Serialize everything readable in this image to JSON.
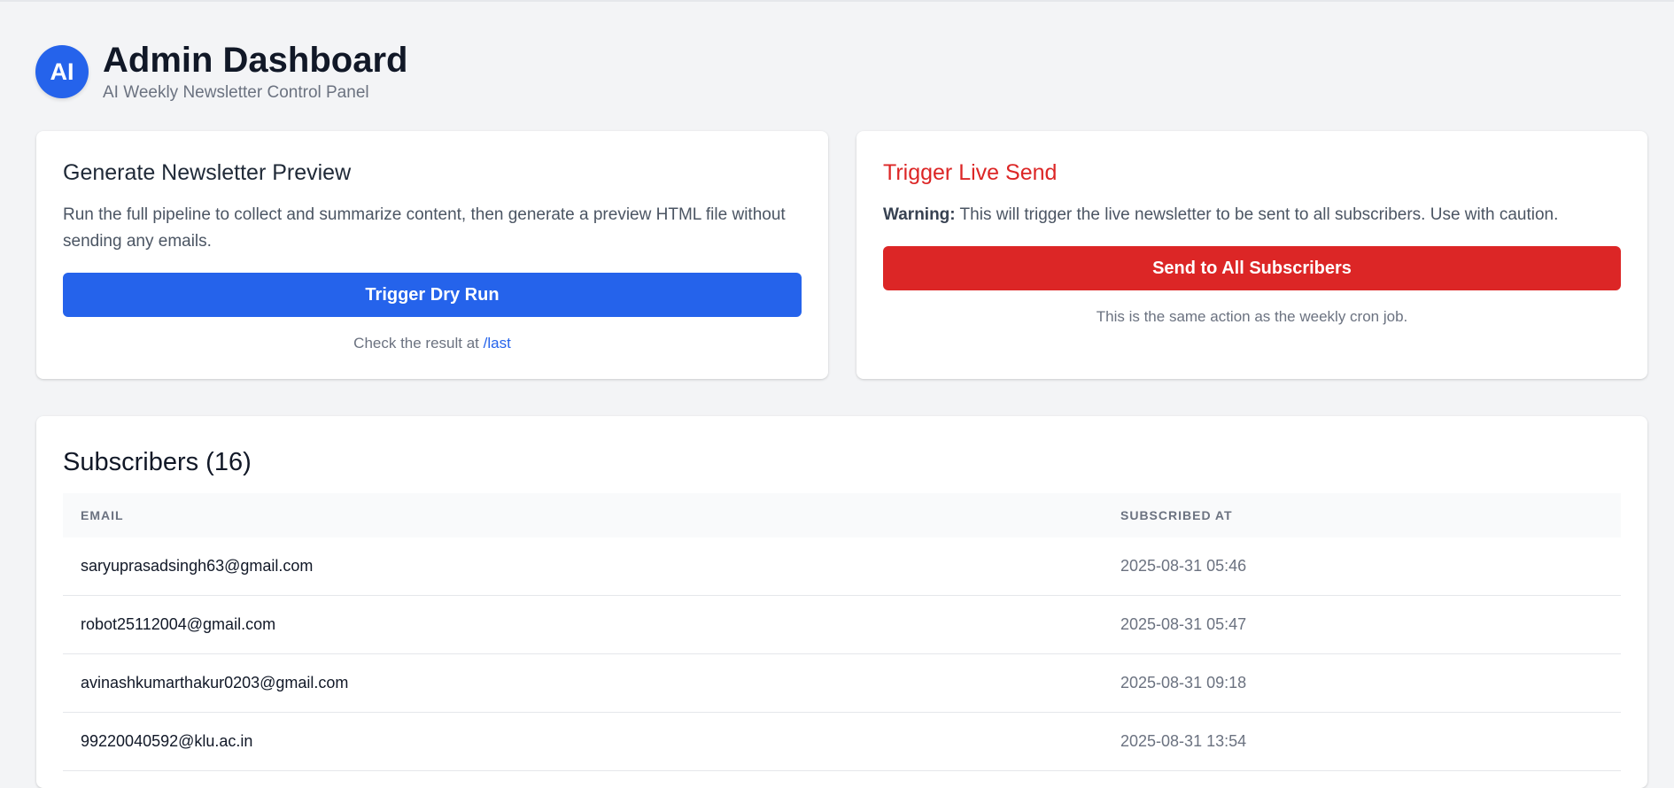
{
  "header": {
    "avatar_text": "AI",
    "title": "Admin Dashboard",
    "subtitle": "AI Weekly Newsletter Control Panel"
  },
  "dry_run": {
    "title": "Generate Newsletter Preview",
    "description": "Run the full pipeline to collect and summarize content, then generate a preview HTML file without sending any emails.",
    "button_label": "Trigger Dry Run",
    "hint_prefix": "Check the result at ",
    "hint_link": "/last"
  },
  "live_send": {
    "title": "Trigger Live Send",
    "warning_label": "Warning:",
    "warning_text": " This will trigger the live newsletter to be sent to all subscribers. Use with caution.",
    "button_label": "Send to All Subscribers",
    "hint": "This is the same action as the weekly cron job."
  },
  "subscribers": {
    "title": "Subscribers (16)",
    "columns": [
      "EMAIL",
      "SUBSCRIBED AT"
    ],
    "rows": [
      {
        "email": "saryuprasadsingh63@gmail.com",
        "subscribed_at": "2025-08-31 05:46"
      },
      {
        "email": "robot25112004@gmail.com",
        "subscribed_at": "2025-08-31 05:47"
      },
      {
        "email": "avinashkumarthakur0203@gmail.com",
        "subscribed_at": "2025-08-31 09:18"
      },
      {
        "email": "99220040592@klu.ac.in",
        "subscribed_at": "2025-08-31 13:54"
      }
    ]
  },
  "colors": {
    "primary": "#2563eb",
    "danger": "#dc2626",
    "background": "#f3f4f6"
  }
}
